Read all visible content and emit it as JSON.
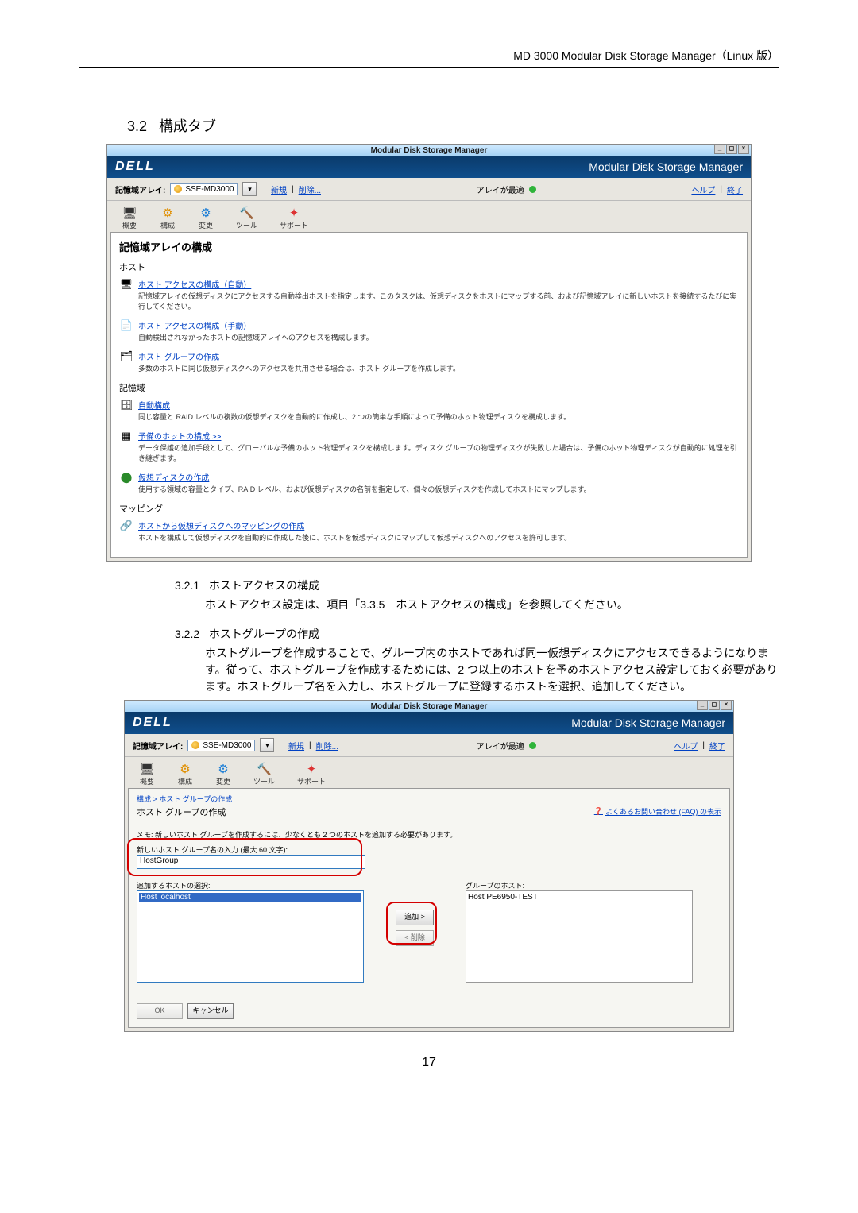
{
  "doc": {
    "header": "MD 3000 Modular Disk Storage Manager（Linux 版）",
    "section_no": "3.2",
    "section_title": "構成タブ",
    "page_number": "17"
  },
  "shot1": {
    "window_title": "Modular Disk Storage Manager",
    "brand": "DELL",
    "brand_sub": "Modular Disk Storage Manager",
    "array_label": "記憶域アレイ:",
    "array_value": "SSE-MD3000",
    "link_new": "新規",
    "link_del": "削除...",
    "status_text": "アレイが最適",
    "link_help": "ヘルプ",
    "link_exit": "終了",
    "tabs": [
      "概要",
      "構成",
      "変更",
      "ツール",
      "サポート"
    ],
    "content_title": "記憶域アレイの構成",
    "groups": {
      "host": "ホスト",
      "storage": "記憶域",
      "mapping": "マッピング"
    },
    "items": {
      "host_auto_t": "ホスト アクセスの構成（自動）",
      "host_auto_d": "記憶域アレイの仮想ディスクにアクセスする自動検出ホストを指定します。このタスクは、仮想ディスクをホストにマップする前、および記憶域アレイに新しいホストを接続するたびに実行してください。",
      "host_manual_t": "ホスト アクセスの構成（手動）",
      "host_manual_d": "自動検出されなかったホストの記憶域アレイへのアクセスを構成します。",
      "hostgroup_t": "ホスト グループの作成",
      "hostgroup_d": "多数のホストに同じ仮想ディスクへのアクセスを共用させる場合は、ホスト グループを作成します。",
      "auto_t": "自動構成",
      "auto_d": "同じ容量と RAID レベルの複数の仮想ディスクを自動的に作成し、2 つの簡単な手順によって予備のホット物理ディスクを構成します。",
      "spare_t": "予備のホットの構成 >>",
      "spare_d": "データ保護の追加手段として、グローバルな予備のホット物理ディスクを構成します。ディスク グループの物理ディスクが失敗した場合は、予備のホット物理ディスクが自動的に処理を引き継ぎます。",
      "vdisk_t": "仮想ディスクの作成",
      "vdisk_d": "使用する領域の容量とタイプ、RAID レベル、および仮想ディスクの名前を指定して、個々の仮想ディスクを作成してホストにマップします。",
      "map_t": "ホストから仮想ディスクへのマッピングの作成",
      "map_d": "ホストを構成して仮想ディスクを自動的に作成した後に、ホストを仮想ディスクにマップして仮想ディスクへのアクセスを許可します。"
    }
  },
  "sub1": {
    "no": "3.2.1",
    "title": "ホストアクセスの構成",
    "body": "ホストアクセス設定は、項目「3.3.5　ホストアクセスの構成」を参照してください。"
  },
  "sub2": {
    "no": "3.2.2",
    "title": "ホストグループの作成",
    "body": "ホストグループを作成することで、グループ内のホストであれば同一仮想ディスクにアクセスできるようになります。従って、ホストグループを作成するためには、2 つ以上のホストを予めホストアクセス設定しておく必要があります。ホストグループ名を入力し、ホストグループに登録するホストを選択、追加してください。"
  },
  "shot2": {
    "window_title": "Modular Disk Storage Manager",
    "brand": "DELL",
    "brand_sub": "Modular Disk Storage Manager",
    "array_label": "記憶域アレイ:",
    "array_value": "SSE-MD3000",
    "link_new": "新規",
    "link_del": "削除...",
    "status_text": "アレイが最適",
    "link_help": "ヘルプ",
    "link_exit": "終了",
    "tabs": [
      "概要",
      "構成",
      "変更",
      "ツール",
      "サポート"
    ],
    "breadcrumb": "構成 > ホスト グループの作成",
    "panel_title": "ホスト グループの作成",
    "faq": "よくあるお問い合わせ (FAQ) の表示",
    "memo": "メモ: 新しいホスト グループを作成するには、少なくとも 2 つのホストを追加する必要があります。",
    "name_label": "新しいホスト グループ名の入力 (最大 60 文字):",
    "name_value": "HostGroup",
    "select_label": "追加するホストの選択:",
    "select_item": "Host localhost",
    "group_label": "グループのホスト:",
    "group_item": "Host PE6950-TEST",
    "btn_add": "追加 >",
    "btn_remove": "< 削除",
    "btn_ok": "OK",
    "btn_cancel": "キャンセル"
  }
}
